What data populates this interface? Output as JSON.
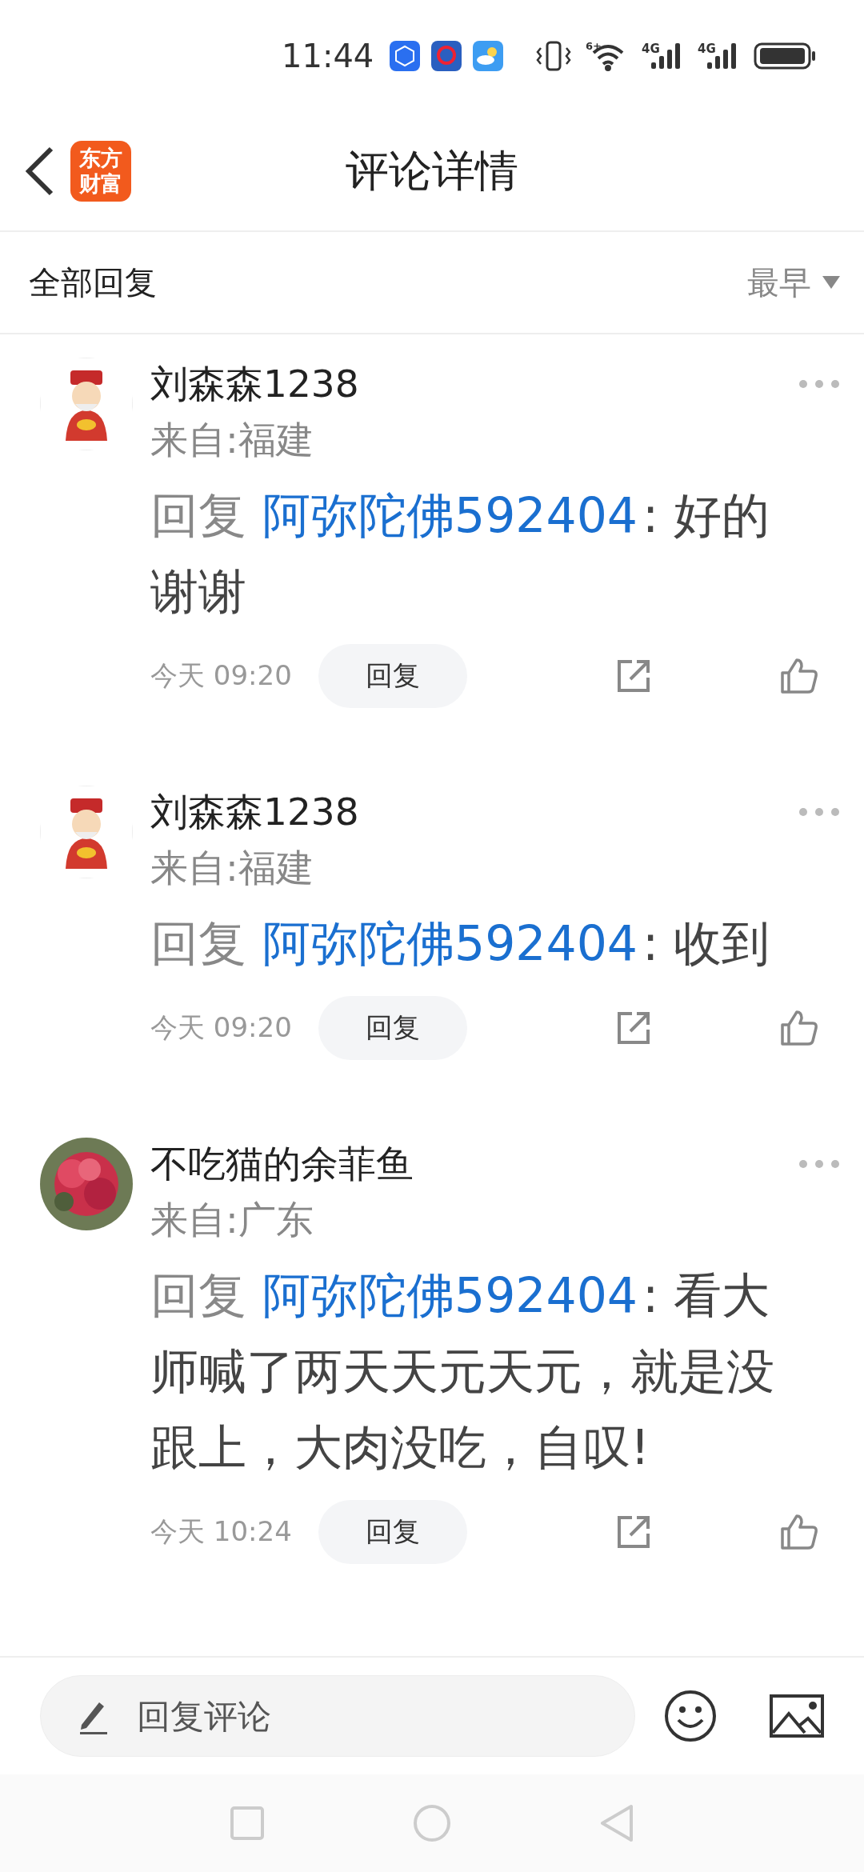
{
  "status_bar": {
    "time": "11:44",
    "wifi": "6+",
    "signals": [
      "4G",
      "4G"
    ]
  },
  "header": {
    "logo": "东方财富",
    "title": "评论详情"
  },
  "filter": {
    "label": "全部回复",
    "sort": "最早"
  },
  "comments": [
    {
      "user": "刘森森1238",
      "location": "来自:福建",
      "prefix": "回复",
      "mention": "阿弥陀佛592404",
      "text": ": 好的谢谢",
      "time": "今天 09:20",
      "reply_button": "回复"
    },
    {
      "user": "刘森森1238",
      "location": "来自:福建",
      "prefix": "回复",
      "mention": "阿弥陀佛592404",
      "text": ": 收到",
      "time": "今天 09:20",
      "reply_button": "回复"
    },
    {
      "user": "不吃猫的余菲鱼",
      "location": "来自:广东",
      "prefix": "回复",
      "mention": "阿弥陀佛592404",
      "text": ": 看大师喊了两天天元天元，就是没跟上，大肉没吃，自叹!",
      "time": "今天 10:24",
      "reply_button": "回复"
    }
  ],
  "compose": {
    "placeholder": "回复评论"
  }
}
